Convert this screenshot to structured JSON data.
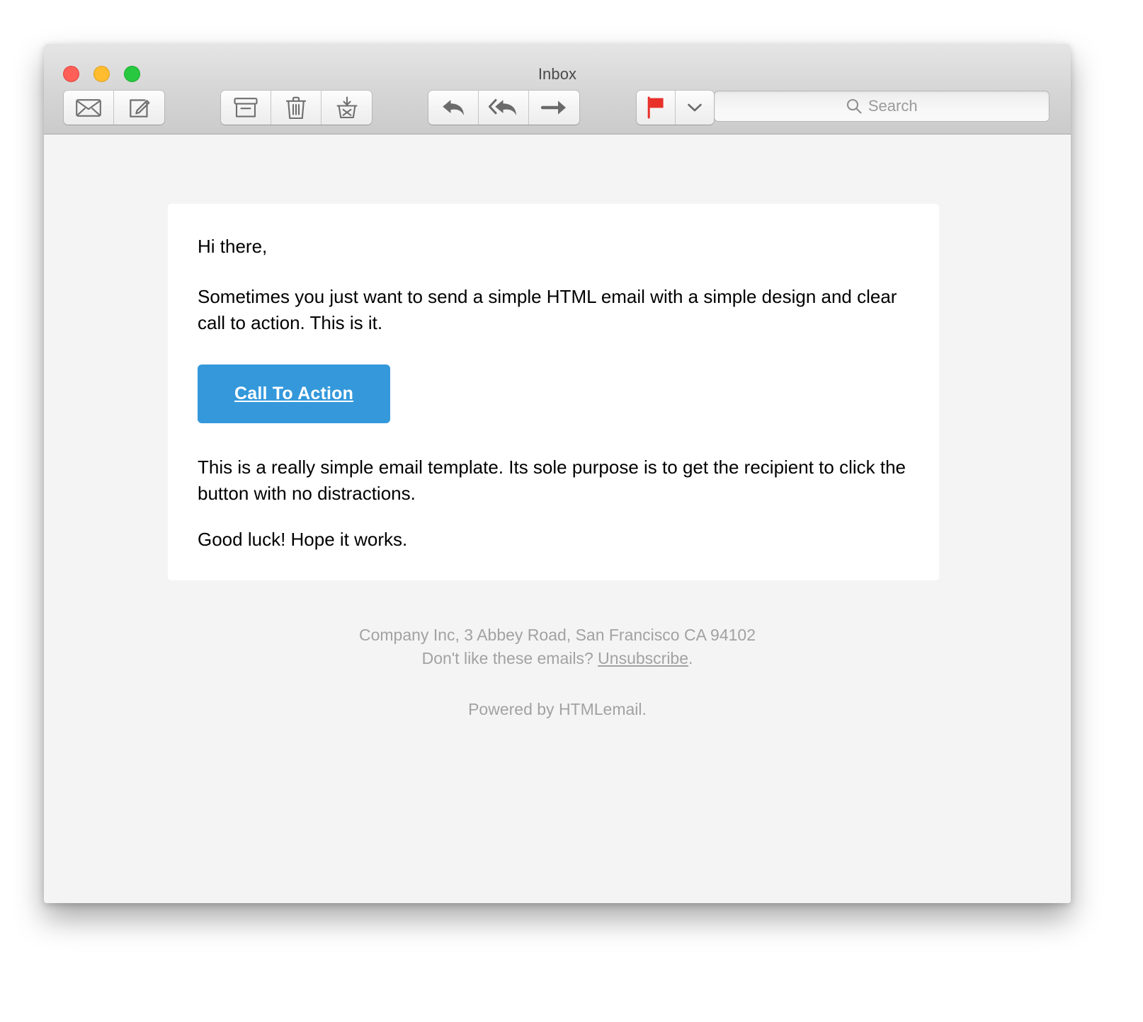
{
  "window": {
    "title": "Inbox",
    "traffic_lights": [
      {
        "name": "close",
        "color": "#ff5f57"
      },
      {
        "name": "minimize",
        "color": "#febc2e"
      },
      {
        "name": "maximize",
        "color": "#28c840"
      }
    ]
  },
  "toolbar": {
    "groups": [
      {
        "buttons": [
          {
            "icon": "envelope-icon",
            "label": "Get Mail"
          },
          {
            "icon": "compose-icon",
            "label": "Compose"
          }
        ]
      },
      {
        "buttons": [
          {
            "icon": "archive-icon",
            "label": "Archive"
          },
          {
            "icon": "trash-icon",
            "label": "Delete"
          },
          {
            "icon": "junk-icon",
            "label": "Junk"
          }
        ]
      },
      {
        "buttons": [
          {
            "icon": "reply-icon",
            "label": "Reply"
          },
          {
            "icon": "reply-all-icon",
            "label": "Reply All"
          },
          {
            "icon": "forward-icon",
            "label": "Forward"
          }
        ]
      },
      {
        "buttons": [
          {
            "icon": "flag-icon",
            "label": "Flag",
            "color": "#e8302a"
          },
          {
            "icon": "chevron-down-icon",
            "label": "Flag Options"
          }
        ]
      }
    ]
  },
  "search": {
    "icon": "search-icon",
    "placeholder": "Search",
    "value": ""
  },
  "email": {
    "greeting": "Hi there,",
    "paragraph_1": "Sometimes you just want to send a simple HTML email with a simple design and clear call to action. This is it.",
    "cta_label": "Call To Action",
    "cta_color": "#3498db",
    "paragraph_2": "This is a really simple email template. Its sole purpose is to get the recipient to click the button with no distractions.",
    "paragraph_3": "Good luck! Hope it works."
  },
  "footer": {
    "address": "Company Inc, 3 Abbey Road, San Francisco CA 94102",
    "unsubscribe_prefix": "Don't like these emails? ",
    "unsubscribe_link": "Unsubscribe",
    "unsubscribe_suffix": ".",
    "powered_by": "Powered by HTMLemail."
  }
}
